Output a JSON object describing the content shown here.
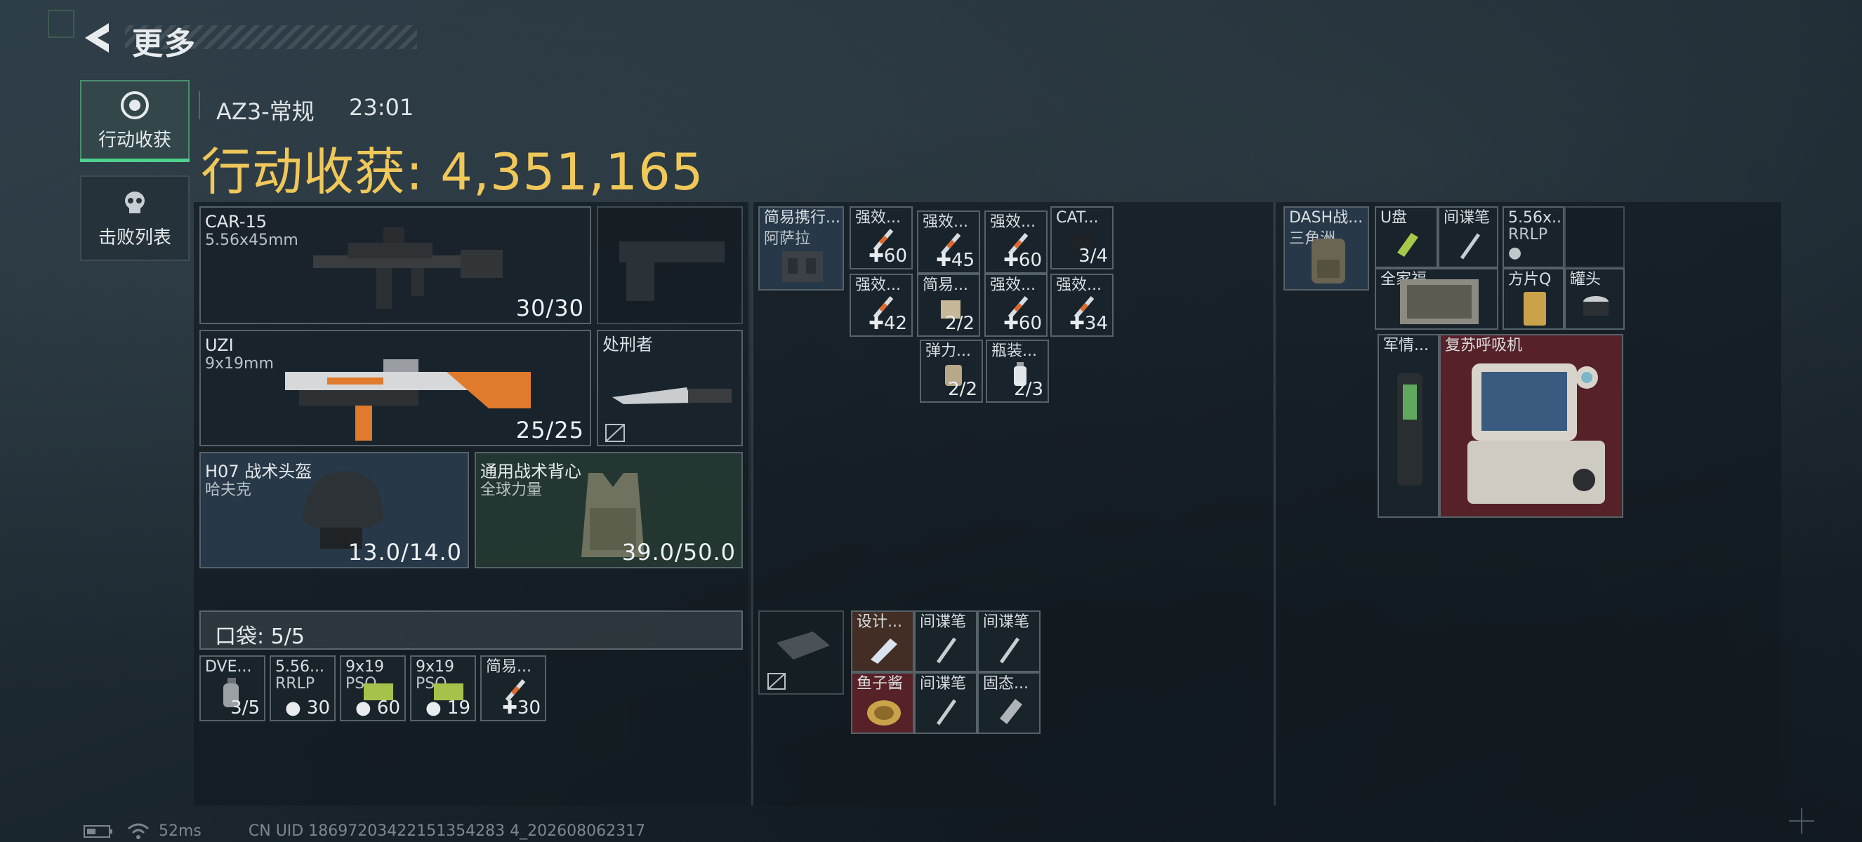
{
  "header": {
    "title": "更多"
  },
  "tabs": [
    {
      "label": "行动收获",
      "icon": "eye-circle-icon",
      "active": true
    },
    {
      "label": "击败列表",
      "icon": "skull-icon",
      "active": false
    }
  ],
  "match": {
    "mode": "AZ3-常规",
    "time": "23:01"
  },
  "income": {
    "label": "行动收获:",
    "value": "4,351,165"
  },
  "equipment": {
    "primary": {
      "name": "CAR-15",
      "caliber": "5.56x45mm",
      "ammo": "30/30"
    },
    "secondary": {
      "name": "UZI",
      "caliber": "9x19mm",
      "ammo": "25/25"
    },
    "melee": {
      "name": "处刑者"
    },
    "helmet": {
      "name": "H07 战术头盔",
      "brand": "哈夫克",
      "durability": "13.0/14.0"
    },
    "armor": {
      "name": "通用战术背心",
      "brand": "全球力量",
      "durability": "39.0/50.0"
    }
  },
  "pocket": {
    "label": "口袋:",
    "count": "5/5",
    "items": [
      {
        "name": "DVE...",
        "count": "3/5"
      },
      {
        "name": "5.56...",
        "sub": "RRLP",
        "count": "30"
      },
      {
        "name": "9x19",
        "sub": "PSO",
        "count": "60"
      },
      {
        "name": "9x19",
        "sub": "PSO",
        "count": "19"
      },
      {
        "name": "简易...",
        "count": "30"
      }
    ]
  },
  "chest_rig": {
    "name": "简易携行...",
    "brand": "阿萨拉",
    "items": [
      {
        "name": "强效...",
        "count": "60"
      },
      {
        "name": "强效...",
        "count": "45"
      },
      {
        "name": "强效...",
        "count": "60"
      },
      {
        "name": "CAT...",
        "count": "3/4"
      },
      {
        "name": "强效...",
        "count": "42"
      },
      {
        "name": "简易...",
        "count": "2/2"
      },
      {
        "name": "强效...",
        "count": "60"
      },
      {
        "name": "强效...",
        "count": "34"
      },
      {
        "name": "弹力...",
        "count": "2/2"
      },
      {
        "name": "瓶装...",
        "count": "2/3"
      }
    ]
  },
  "safebox": {
    "items": [
      {
        "name": "设计..."
      },
      {
        "name": "间谍笔"
      },
      {
        "name": "间谍笔"
      },
      {
        "name": "鱼子酱"
      },
      {
        "name": "间谍笔"
      },
      {
        "name": "固态..."
      }
    ]
  },
  "backpack": {
    "name": "DASH战...",
    "brand": "三角洲",
    "items": [
      {
        "name": "U盘"
      },
      {
        "name": "间谍笔"
      },
      {
        "name": "5.56x...",
        "sub": "RRLP"
      },
      {
        "name": "全家福"
      },
      {
        "name": "方片Q"
      },
      {
        "name": "罐头"
      },
      {
        "name": "军情..."
      },
      {
        "name": "复苏呼吸机"
      }
    ]
  },
  "status": {
    "ping": "52ms",
    "uid": "CN UID 18697203422151354283 4_202608062317"
  },
  "colors": {
    "accent_green": "#4fd28e",
    "gold": "#f0c85a",
    "red_rare": "#5c2228"
  }
}
